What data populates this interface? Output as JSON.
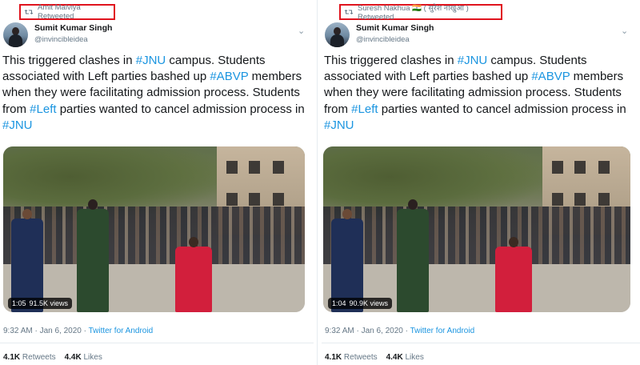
{
  "tweets": [
    {
      "retweeted_by": "Amit Malviya Retweeted",
      "author": {
        "name": "Sumit Kumar Singh",
        "handle": "@invincibleidea"
      },
      "body": [
        {
          "t": "This triggered clashes in "
        },
        {
          "t": "#JNU",
          "tag": true
        },
        {
          "t": " campus. Students associated with Left parties bashed up "
        },
        {
          "t": "#ABVP",
          "tag": true
        },
        {
          "t": " members when they were facilitating admission process. Students from "
        },
        {
          "t": "#Left",
          "tag": true
        },
        {
          "t": " parties wanted to cancel admission process in "
        },
        {
          "t": "#JNU",
          "tag": true
        }
      ],
      "video": {
        "duration": "1:05",
        "views": "91.5K views"
      },
      "time": "9:32 AM · Jan 6, 2020",
      "source": "Twitter for Android",
      "retweets": "4.1K",
      "retweets_label": "Retweets",
      "likes": "4.4K",
      "likes_label": "Likes"
    },
    {
      "retweeted_by": "Suresh Nakhua 🇮🇳 ( सुरेश नाखुआ ) Retweeted",
      "author": {
        "name": "Sumit Kumar Singh",
        "handle": "@invincibleidea"
      },
      "body": [
        {
          "t": "This triggered clashes in "
        },
        {
          "t": "#JNU",
          "tag": true
        },
        {
          "t": " campus. Students associated with Left parties bashed up "
        },
        {
          "t": "#ABVP",
          "tag": true
        },
        {
          "t": " members when they were facilitating admission process. Students from "
        },
        {
          "t": "#Left",
          "tag": true
        },
        {
          "t": " parties wanted to cancel admission process in "
        },
        {
          "t": "#JNU",
          "tag": true
        }
      ],
      "video": {
        "duration": "1:04",
        "views": "90.9K views"
      },
      "time": "9:32 AM · Jan 6, 2020",
      "source": "Twitter for Android",
      "retweets": "4.1K",
      "retweets_label": "Retweets",
      "likes": "4.4K",
      "likes_label": "Likes"
    }
  ],
  "colors": {
    "link": "#1b95e0",
    "muted": "#657786",
    "highlight_box": "#e0141e",
    "text": "#14171a"
  },
  "icons": {
    "retweet": "retweet-icon",
    "caret": "chevron-down-icon"
  }
}
